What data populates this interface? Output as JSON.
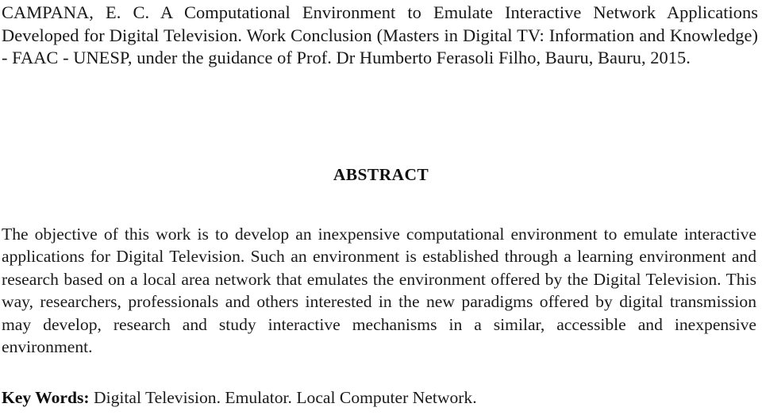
{
  "document": {
    "type": "scanned-academic-abstract-page",
    "background_color": "#ffffff",
    "text_color": "#1b1b1b",
    "citation": "CAMPANA, E. C. A Computational Environment to Emulate Interactive Network Applications Developed for Digital Television. Work Conclusion (Masters in Digital TV: Information and Knowledge) - FAAC - UNESP, under the guidance of Prof. Dr Humberto Ferasoli Filho, Bauru, Bauru, 2015.",
    "abstract_heading": "ABSTRACT",
    "abstract_body": "The objective of this work is to develop an inexpensive computational environment to emulate interactive applications for Digital Television. Such an environment is established through a learning environment and research based on a local area network that emulates the environment offered by the Digital Television. This way, researchers, professionals and others interested in the new paradigms offered by digital transmission may develop, research and study interactive mechanisms  in a similar, accessible and inexpensive environment.",
    "keywords": {
      "label": "Key Words:",
      "values": " Digital Television. Emulator. Local Computer Network."
    }
  }
}
